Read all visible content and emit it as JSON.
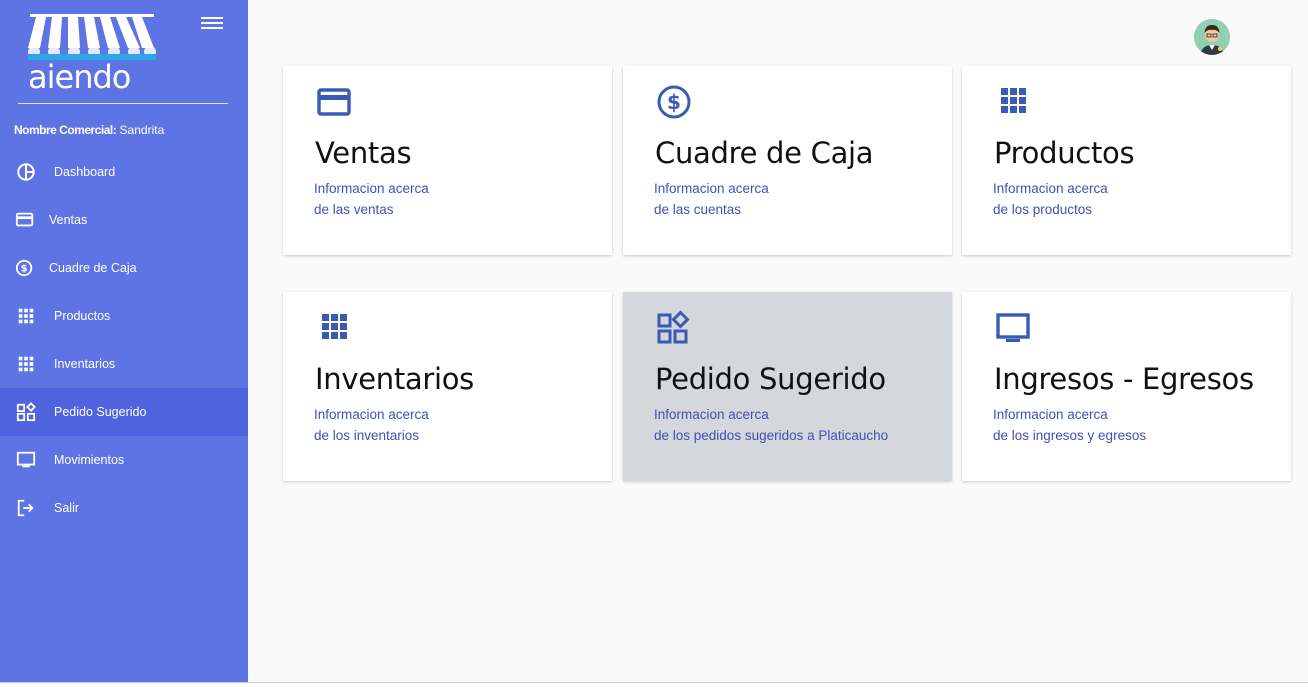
{
  "app": {
    "logo_text": "aiendo",
    "business_label": "Nombre Comercial:",
    "business_name": "Sandrita"
  },
  "colors": {
    "sidebar": "#5f74e4",
    "sidebar_active": "#4f63de",
    "icon_blue": "#3a5bb5",
    "desc_blue": "#3f51b5",
    "card_hover": "#d4d7db"
  },
  "sidebar": {
    "items": [
      {
        "label": "Dashboard",
        "icon": "pie-chart-icon"
      },
      {
        "label": "Ventas",
        "icon": "credit-card-icon"
      },
      {
        "label": "Cuadre de Caja",
        "icon": "dollar-circle-icon"
      },
      {
        "label": "Productos",
        "icon": "grid-icon"
      },
      {
        "label": "Inventarios",
        "icon": "grid-icon"
      },
      {
        "label": "Pedido Sugerido",
        "icon": "widgets-icon",
        "active": true
      },
      {
        "label": "Movimientos",
        "icon": "monitor-icon"
      },
      {
        "label": "Salir",
        "icon": "logout-icon"
      }
    ]
  },
  "cards": [
    {
      "title": "Ventas",
      "line1": "Informacion acerca",
      "line2": "de las ventas",
      "icon": "credit-card-icon"
    },
    {
      "title": "Cuadre de Caja",
      "line1": "Informacion acerca",
      "line2": "de las cuentas",
      "icon": "dollar-circle-icon"
    },
    {
      "title": "Productos",
      "line1": "Informacion acerca",
      "line2": "de los productos",
      "icon": "grid-icon"
    },
    {
      "title": "Inventarios",
      "line1": "Informacion acerca",
      "line2": "de los inventarios",
      "icon": "grid-icon"
    },
    {
      "title": "Pedido Sugerido",
      "line1": "Informacion acerca",
      "line2": "de los pedidos sugeridos a Platicaucho",
      "icon": "widgets-icon",
      "hover": true
    },
    {
      "title": "Ingresos - Egresos",
      "line1": "Informacion acerca",
      "line2": "de los ingresos y egresos",
      "icon": "monitor-icon"
    }
  ]
}
